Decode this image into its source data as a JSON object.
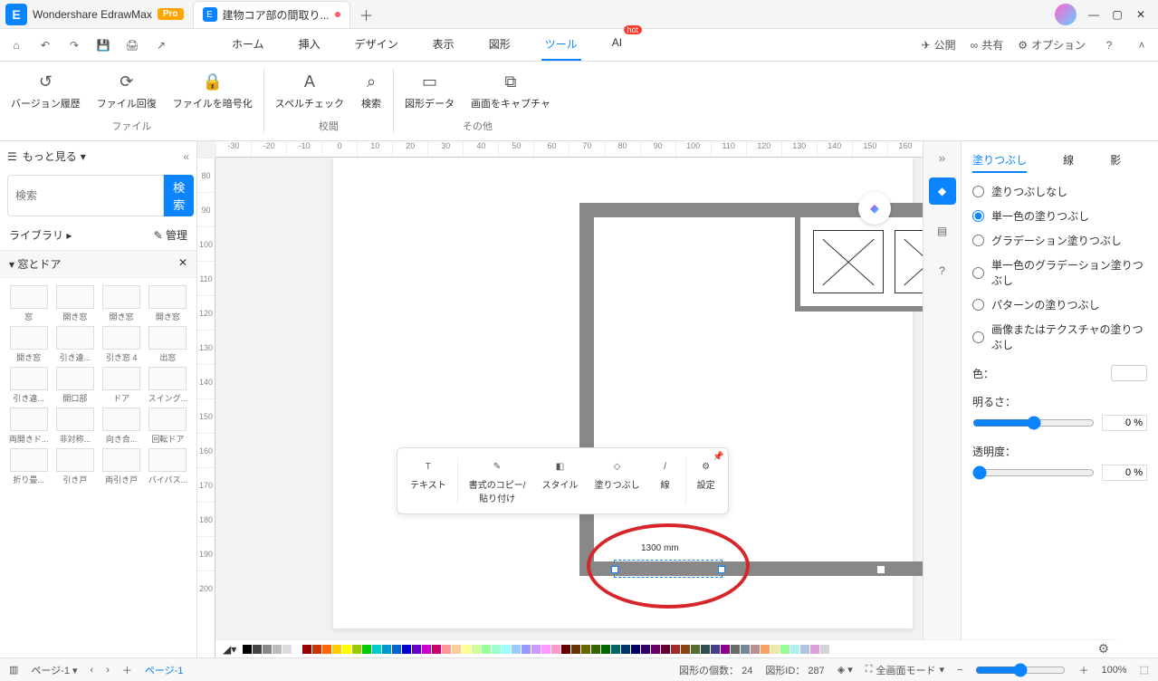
{
  "app": {
    "name": "Wondershare EdrawMax",
    "pro": "Pro"
  },
  "tab": {
    "title": "建物コア部の間取り..."
  },
  "menu": {
    "tabs": [
      "ホーム",
      "挿入",
      "デザイン",
      "表示",
      "図形",
      "ツール",
      "AI"
    ],
    "active": "ツール",
    "hot": "hot",
    "right": {
      "publish": "公開",
      "share": "共有",
      "options": "オプション"
    }
  },
  "ribbon": {
    "groups": [
      {
        "label": "ファイル",
        "items": [
          {
            "icon": "↺",
            "text": "バージョン履歴"
          },
          {
            "icon": "⟳",
            "text": "ファイル回復"
          },
          {
            "icon": "🔒",
            "text": "ファイルを暗号化"
          }
        ]
      },
      {
        "label": "校閲",
        "items": [
          {
            "icon": "A",
            "text": "スペルチェック"
          },
          {
            "icon": "⌕",
            "text": "検索"
          }
        ]
      },
      {
        "label": "その他",
        "items": [
          {
            "icon": "▭",
            "text": "図形データ"
          },
          {
            "icon": "⧉",
            "text": "画面をキャプチャ"
          }
        ]
      }
    ]
  },
  "leftPanel": {
    "more": "もっと見る",
    "searchPlaceholder": "検索",
    "searchBtn": "検索",
    "library": "ライブラリ",
    "manage": "管理",
    "section": "窓とドア",
    "shapes": [
      "窓",
      "開き窓",
      "開き窓",
      "開き窓",
      "開き窓",
      "引き違...",
      "引き窓 4",
      "出窓",
      "引き違...",
      "開口部",
      "ドア",
      "スイング...",
      "両開きド...",
      "非対称...",
      "向き合...",
      "回転ドア",
      "折り畳...",
      "引き戸",
      "両引き戸",
      "バイパス..."
    ]
  },
  "ruler": {
    "h": [
      "-30",
      "-20",
      "-10",
      "0",
      "10",
      "20",
      "30",
      "40",
      "50",
      "60",
      "70",
      "80",
      "90",
      "100",
      "110",
      "120",
      "130",
      "140",
      "150",
      "160"
    ],
    "v": [
      "80",
      "90",
      "100",
      "110",
      "120",
      "130",
      "140",
      "150",
      "160",
      "170",
      "180",
      "190",
      "200"
    ]
  },
  "canvas": {
    "doorLabel": "1300 mm"
  },
  "floatToolbar": {
    "items": [
      {
        "icon": "T",
        "text": "テキスト"
      },
      {
        "icon": "✎",
        "text": "書式のコピー/\n貼り付け"
      },
      {
        "icon": "◧",
        "text": "スタイル"
      },
      {
        "icon": "◇",
        "text": "塗りつぶし"
      },
      {
        "icon": "/",
        "text": "線"
      },
      {
        "icon": "⚙",
        "text": "設定"
      }
    ]
  },
  "rightPanel": {
    "tabs": [
      "塗りつぶし",
      "線",
      "影"
    ],
    "active": "塗りつぶし",
    "radios": [
      "塗りつぶしなし",
      "単一色の塗りつぶし",
      "グラデーション塗りつぶし",
      "単一色のグラデーション塗りつぶし",
      "パターンの塗りつぶし",
      "画像またはテクスチャの塗りつぶし"
    ],
    "selected": 1,
    "color": "色：",
    "brightness": "明るさ：",
    "brightnessVal": "0 %",
    "opacity": "透明度：",
    "opacityVal": "0 %"
  },
  "status": {
    "page": "ページ-1",
    "pageTab": "ページ-1",
    "shapeCount": "図形の個数： 24",
    "shapeId": "図形ID： 287",
    "fullscreen": "全画面モード",
    "zoom": "100%"
  }
}
